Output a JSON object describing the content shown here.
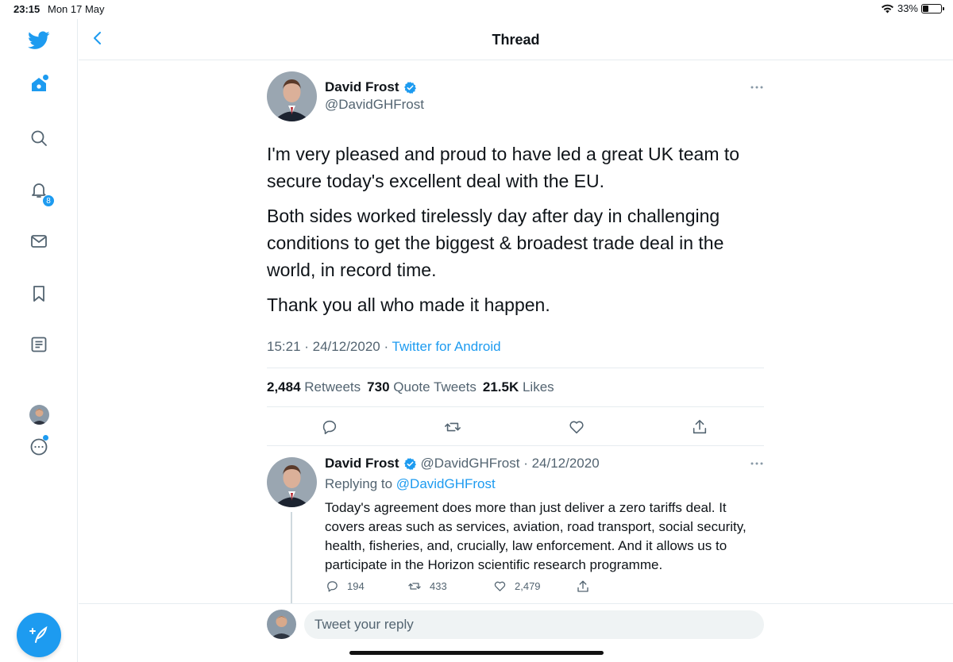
{
  "status_bar": {
    "time": "23:15",
    "date": "Mon 17 May",
    "battery": "33%",
    "battery_level": 0.33
  },
  "colors": {
    "accent": "#1d9bf0",
    "text": "#0f1419",
    "muted": "#536471",
    "border": "#e6ecf0"
  },
  "sidebar": {
    "items": [
      {
        "icon": "twitter-logo-icon"
      },
      {
        "icon": "home-icon"
      },
      {
        "icon": "search-icon"
      },
      {
        "icon": "notifications-icon",
        "badge": "8"
      },
      {
        "icon": "messages-icon"
      },
      {
        "icon": "bookmarks-icon"
      },
      {
        "icon": "lists-icon"
      },
      {
        "icon": "profile-avatar"
      },
      {
        "icon": "more-icon"
      }
    ],
    "compose": "compose-tweet-icon"
  },
  "header": {
    "title": "Thread"
  },
  "main_tweet": {
    "name": "David Frost",
    "handle": "@DavidGHFrost",
    "paragraphs": [
      "I'm very pleased and proud to have led a great UK team to secure today's excellent deal with the EU.",
      "Both sides worked tirelessly day after day in challenging conditions to get the biggest & broadest trade deal in the world, in record time.",
      "Thank you all who made it happen."
    ],
    "timestamp": "15:21 · 24/12/2020 · ",
    "source": "Twitter for Android",
    "stats": {
      "retweets_count": "2,484",
      "retweets_label": "Retweets",
      "quotes_count": "730",
      "quotes_label": "Quote Tweets",
      "likes_count": "21.5K",
      "likes_label": "Likes"
    }
  },
  "reply_tweet": {
    "name": "David Frost",
    "handle_date": "@DavidGHFrost · 24/12/2020",
    "replying_prefix": "Replying to ",
    "replying_handle": "@DavidGHFrost",
    "text": "Today's agreement does more than just deliver a zero tariffs deal. It covers areas such as services, aviation, road transport, social security, health, fisheries, and, crucially, law enforcement. And it allows us to participate in the Horizon scientific research programme.",
    "replies": "194",
    "retweets": "433",
    "likes": "2,479"
  },
  "composer": {
    "placeholder": "Tweet your reply"
  }
}
